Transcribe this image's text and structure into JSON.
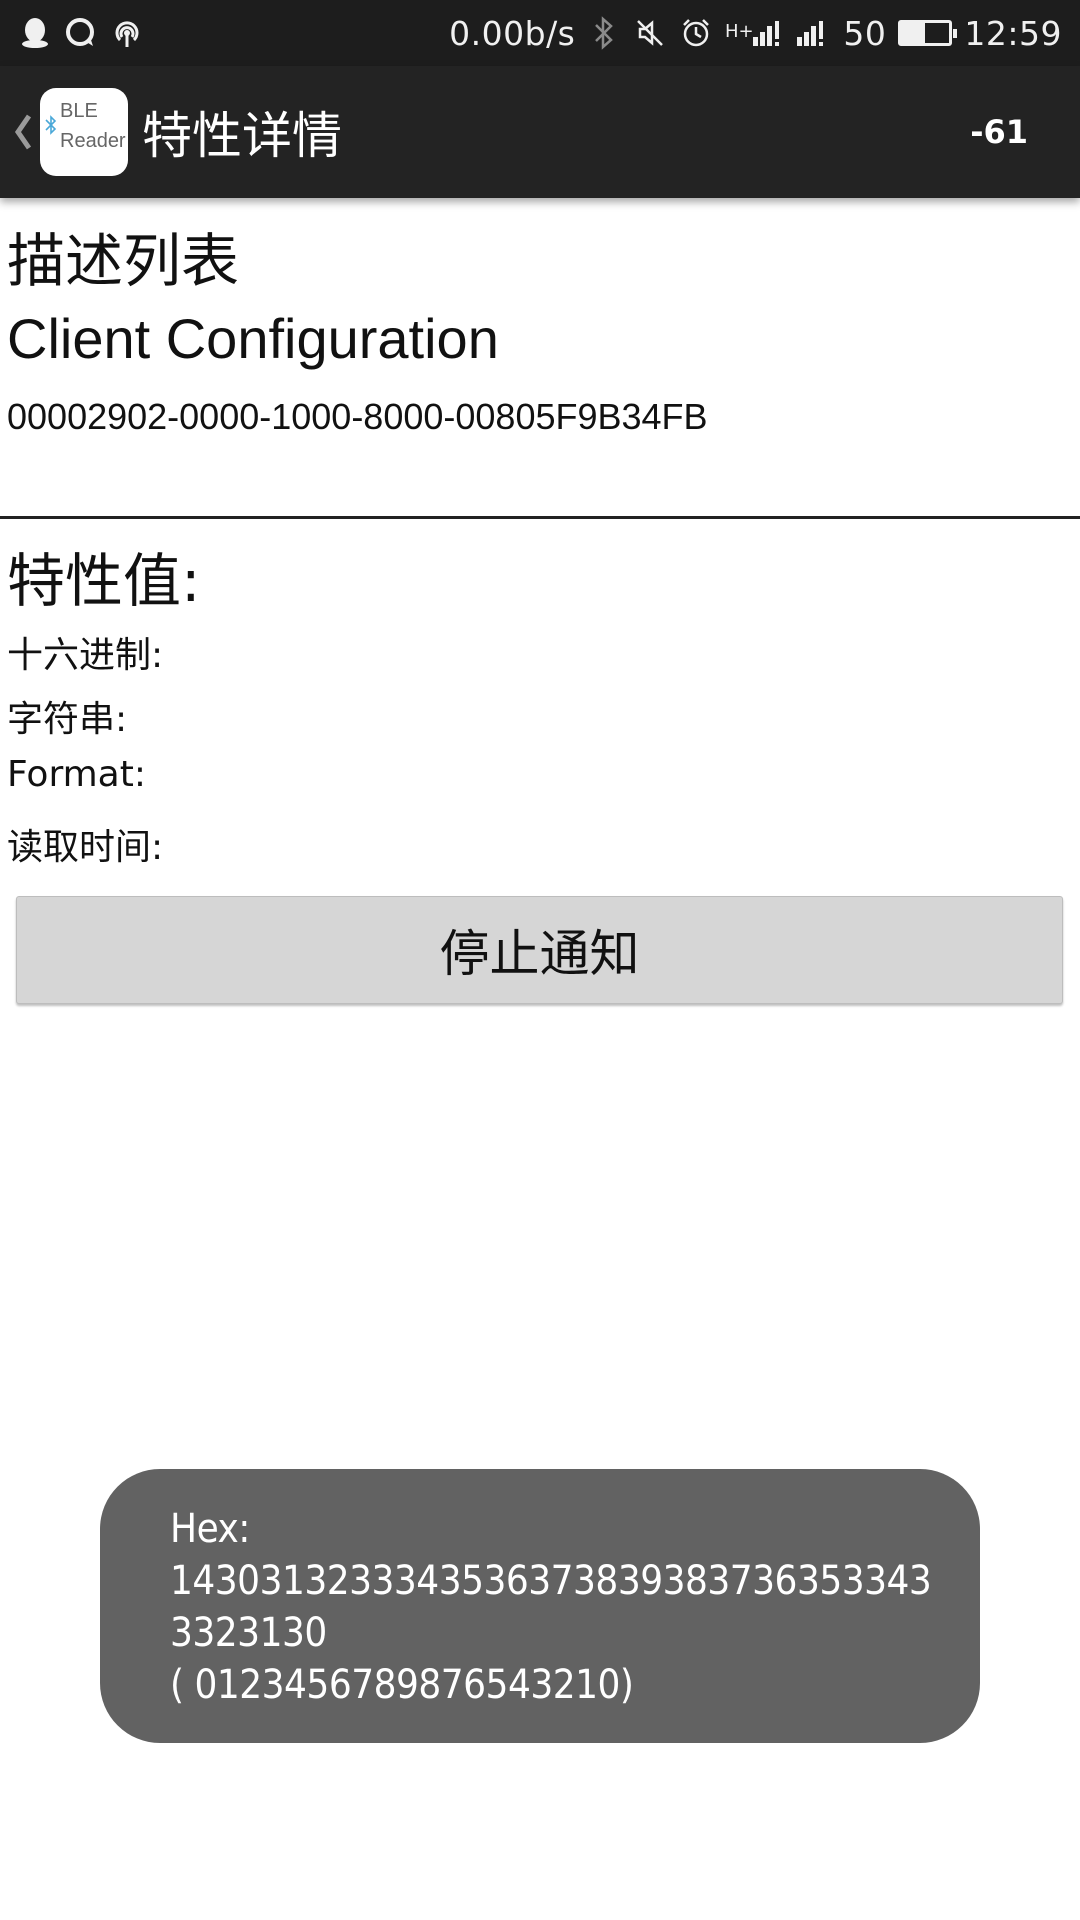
{
  "status_bar": {
    "net_speed": "0.00b/s",
    "signal_label": "50",
    "time": "12:59",
    "battery_level": 0.5,
    "icons": [
      "qq-icon",
      "message-icon",
      "hotspot-icon",
      "bluetooth-icon",
      "mute-icon",
      "alarm-icon",
      "hplus-signal-icon",
      "signal-icon",
      "battery-icon"
    ]
  },
  "action_bar": {
    "logo_line1": "BLE",
    "logo_line2": "Reader",
    "title": "特性详情",
    "rssi": "-61"
  },
  "descriptor": {
    "heading": "描述列表",
    "name": "Client Configuration",
    "uuid": "00002902-0000-1000-8000-00805F9B34FB"
  },
  "characteristic": {
    "heading": "特性值:",
    "hex_label": "十六进制:",
    "string_label": "字符串:",
    "format_label": "Format:",
    "read_time_label": "读取时间:"
  },
  "stop_button_label": "停止通知",
  "toast": {
    "line1": "Hex:",
    "line2": "1430313233343536373839383736353343",
    "line3": "3323130",
    "line4": "( 0123456789876543210)"
  }
}
